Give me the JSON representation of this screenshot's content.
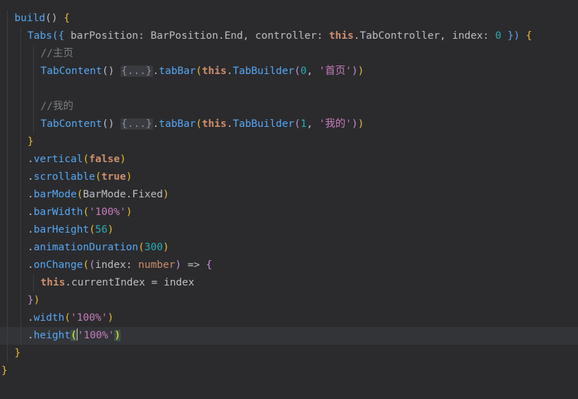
{
  "editor": {
    "lines": [
      {
        "indent": 1,
        "current": false,
        "tokens": [
          {
            "t": "build",
            "c": "fn"
          },
          {
            "t": "() ",
            "c": "plain"
          },
          {
            "t": "{",
            "c": "brace"
          }
        ]
      },
      {
        "indent": 2,
        "current": false,
        "tokens": [
          {
            "t": "Tabs",
            "c": "fn"
          },
          {
            "t": "({ ",
            "c": "paren2"
          },
          {
            "t": "barPosition: BarPosition.End, controller: ",
            "c": "plain"
          },
          {
            "t": "this",
            "c": "kw"
          },
          {
            "t": ".TabController, index: ",
            "c": "plain"
          },
          {
            "t": "0",
            "c": "num"
          },
          {
            "t": " }) ",
            "c": "paren2"
          },
          {
            "t": "{",
            "c": "brace"
          }
        ]
      },
      {
        "indent": 3,
        "current": false,
        "tokens": [
          {
            "t": "//主页",
            "c": "cmt"
          }
        ]
      },
      {
        "indent": 3,
        "current": false,
        "tokens": [
          {
            "t": "TabContent",
            "c": "fn"
          },
          {
            "t": "() ",
            "c": "plain"
          },
          {
            "t": "{...}",
            "c": "fold"
          },
          {
            "t": ".",
            "c": "plain"
          },
          {
            "t": "tabBar",
            "c": "fn"
          },
          {
            "t": "(",
            "c": "brace"
          },
          {
            "t": "this",
            "c": "kw"
          },
          {
            "t": ".",
            "c": "plain"
          },
          {
            "t": "TabBuilder",
            "c": "fn"
          },
          {
            "t": "(",
            "c": "paren"
          },
          {
            "t": "0",
            "c": "num"
          },
          {
            "t": ", ",
            "c": "plain"
          },
          {
            "t": "'首页'",
            "c": "str2"
          },
          {
            "t": ")",
            "c": "paren"
          },
          {
            "t": ")",
            "c": "brace"
          }
        ]
      },
      {
        "indent": 3,
        "current": false,
        "tokens": []
      },
      {
        "indent": 3,
        "current": false,
        "tokens": [
          {
            "t": "//我的",
            "c": "cmt"
          }
        ]
      },
      {
        "indent": 3,
        "current": false,
        "tokens": [
          {
            "t": "TabContent",
            "c": "fn"
          },
          {
            "t": "() ",
            "c": "plain"
          },
          {
            "t": "{...}",
            "c": "fold"
          },
          {
            "t": ".",
            "c": "plain"
          },
          {
            "t": "tabBar",
            "c": "fn"
          },
          {
            "t": "(",
            "c": "brace"
          },
          {
            "t": "this",
            "c": "kw"
          },
          {
            "t": ".",
            "c": "plain"
          },
          {
            "t": "TabBuilder",
            "c": "fn"
          },
          {
            "t": "(",
            "c": "paren"
          },
          {
            "t": "1",
            "c": "num"
          },
          {
            "t": ", ",
            "c": "plain"
          },
          {
            "t": "'我的'",
            "c": "str2"
          },
          {
            "t": ")",
            "c": "paren"
          },
          {
            "t": ")",
            "c": "brace"
          }
        ]
      },
      {
        "indent": 2,
        "current": false,
        "tokens": [
          {
            "t": "}",
            "c": "brace"
          }
        ]
      },
      {
        "indent": 2,
        "current": false,
        "tokens": [
          {
            "t": ".",
            "c": "plain"
          },
          {
            "t": "vertical",
            "c": "fn"
          },
          {
            "t": "(",
            "c": "brace"
          },
          {
            "t": "false",
            "c": "kw"
          },
          {
            "t": ")",
            "c": "brace"
          }
        ]
      },
      {
        "indent": 2,
        "current": false,
        "tokens": [
          {
            "t": ".",
            "c": "plain"
          },
          {
            "t": "scrollable",
            "c": "fn"
          },
          {
            "t": "(",
            "c": "brace"
          },
          {
            "t": "true",
            "c": "kw"
          },
          {
            "t": ")",
            "c": "brace"
          }
        ]
      },
      {
        "indent": 2,
        "current": false,
        "tokens": [
          {
            "t": ".",
            "c": "plain"
          },
          {
            "t": "barMode",
            "c": "fn"
          },
          {
            "t": "(",
            "c": "brace"
          },
          {
            "t": "BarMode.Fixed",
            "c": "plain"
          },
          {
            "t": ")",
            "c": "brace"
          }
        ]
      },
      {
        "indent": 2,
        "current": false,
        "tokens": [
          {
            "t": ".",
            "c": "plain"
          },
          {
            "t": "barWidth",
            "c": "fn"
          },
          {
            "t": "(",
            "c": "brace"
          },
          {
            "t": "'100%'",
            "c": "str2"
          },
          {
            "t": ")",
            "c": "brace"
          }
        ]
      },
      {
        "indent": 2,
        "current": false,
        "tokens": [
          {
            "t": ".",
            "c": "plain"
          },
          {
            "t": "barHeight",
            "c": "fn"
          },
          {
            "t": "(",
            "c": "brace"
          },
          {
            "t": "56",
            "c": "num"
          },
          {
            "t": ")",
            "c": "brace"
          }
        ]
      },
      {
        "indent": 2,
        "current": false,
        "tokens": [
          {
            "t": ".",
            "c": "plain"
          },
          {
            "t": "animationDuration",
            "c": "fn"
          },
          {
            "t": "(",
            "c": "brace"
          },
          {
            "t": "300",
            "c": "num"
          },
          {
            "t": ")",
            "c": "brace"
          }
        ]
      },
      {
        "indent": 2,
        "current": false,
        "tokens": [
          {
            "t": ".",
            "c": "plain"
          },
          {
            "t": "onChange",
            "c": "fn"
          },
          {
            "t": "(",
            "c": "brace"
          },
          {
            "t": "(",
            "c": "paren"
          },
          {
            "t": "index: ",
            "c": "plain"
          },
          {
            "t": "number",
            "c": "type"
          },
          {
            "t": ")",
            "c": "paren"
          },
          {
            "t": " => ",
            "c": "plain"
          },
          {
            "t": "{",
            "c": "paren"
          }
        ]
      },
      {
        "indent": 3,
        "current": false,
        "tokens": [
          {
            "t": "this",
            "c": "kw"
          },
          {
            "t": ".currentIndex = index",
            "c": "plain"
          }
        ]
      },
      {
        "indent": 2,
        "current": false,
        "tokens": [
          {
            "t": "}",
            "c": "paren"
          },
          {
            "t": ")",
            "c": "brace"
          }
        ]
      },
      {
        "indent": 2,
        "current": false,
        "tokens": [
          {
            "t": ".",
            "c": "plain"
          },
          {
            "t": "width",
            "c": "fn"
          },
          {
            "t": "(",
            "c": "brace"
          },
          {
            "t": "'100%'",
            "c": "str2"
          },
          {
            "t": ")",
            "c": "brace"
          }
        ]
      },
      {
        "indent": 2,
        "current": true,
        "tokens": [
          {
            "t": ".",
            "c": "plain"
          },
          {
            "t": "height",
            "c": "fn"
          },
          {
            "t": "(",
            "c": "match"
          },
          {
            "t": "'100%'",
            "c": "str2"
          },
          {
            "t": ")",
            "c": "match"
          }
        ]
      },
      {
        "indent": 1,
        "current": false,
        "tokens": [
          {
            "t": "}",
            "c": "brace"
          }
        ]
      },
      {
        "indent": 0,
        "current": false,
        "tokens": [
          {
            "t": "}",
            "c": "brace"
          }
        ]
      }
    ]
  },
  "colors": {
    "background": "#2b2b2d",
    "current_line": "#323438",
    "function": "#56a8f5",
    "keyword": "#cf8e6d",
    "brace": "#e8ba36",
    "string": "#c77dbb",
    "number": "#2aacb8",
    "comment": "#7a7e85"
  }
}
